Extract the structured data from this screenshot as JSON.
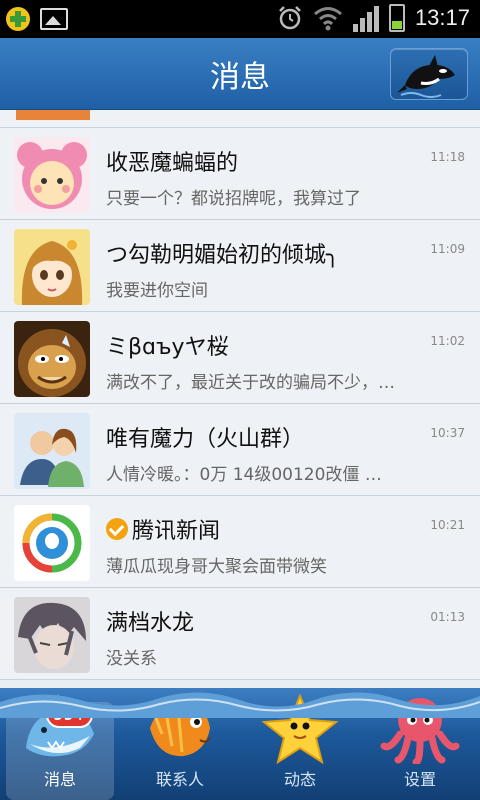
{
  "status_bar": {
    "time": "13:17",
    "battery_level": 0.35,
    "icons": [
      "app-notification-icon",
      "image-notification-icon",
      "alarm-icon",
      "wifi-icon",
      "signal-icon",
      "battery-icon"
    ]
  },
  "header": {
    "title": "消息",
    "action_icon": "orca-icon"
  },
  "messages": [
    {
      "name": "收恶魔蝙蝠的",
      "preview": "只要一个？都说招牌呢，我算过了",
      "time": "11:18",
      "avatar": "pink-bear-avatar",
      "verified": false
    },
    {
      "name": "つ勾勒明媚始初的倾城╮",
      "preview": "我要进你空间",
      "time": "11:09",
      "avatar": "anime-girl-avatar",
      "verified": false
    },
    {
      "name": "ミβɑъуヤ桜",
      "preview": "满改不了，最近关于改的骗局不少，…",
      "time": "11:02",
      "avatar": "lion-cartoon-avatar",
      "verified": false
    },
    {
      "name": "唯有魔力（火山群）",
      "preview": "人情冷暖。：0万    14级00120改僵    …",
      "time": "10:37",
      "avatar": "group-avatar",
      "verified": false
    },
    {
      "name": "腾讯新闻",
      "preview": "薄瓜瓜现身哥大聚会面带微笑",
      "time": "10:21",
      "avatar": "tencent-news-avatar",
      "verified": true
    },
    {
      "name": "满档水龙",
      "preview": "没关系",
      "time": "01:13",
      "avatar": "anime-boy-avatar",
      "verified": false
    }
  ],
  "nav": [
    {
      "label": "消息",
      "icon": "shark-icon",
      "badge": "99+",
      "active": true
    },
    {
      "label": "联系人",
      "icon": "fish-icon",
      "badge": "",
      "active": false
    },
    {
      "label": "动态",
      "icon": "starfish-icon",
      "badge": "",
      "active": false
    },
    {
      "label": "设置",
      "icon": "octopus-icon",
      "badge": "",
      "active": false
    }
  ],
  "colors": {
    "header_blue": "#2a6db3",
    "nav_blue": "#1d5a9c",
    "badge_red": "#e0362f",
    "verified_orange": "#f2a30f"
  }
}
